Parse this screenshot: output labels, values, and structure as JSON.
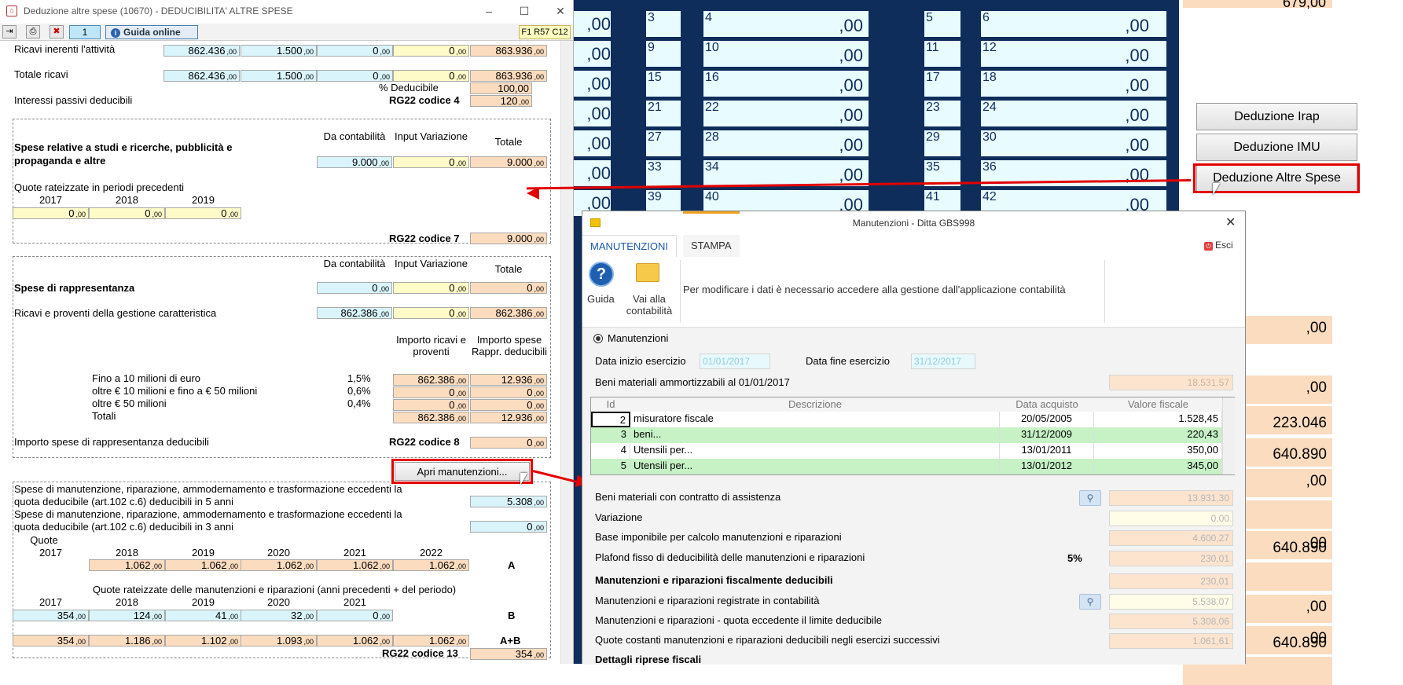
{
  "left_window": {
    "title": "Deduzione altre spese (10670) - DEDUCIBILITA' ALTRE SPESE",
    "toolbar": {
      "page_number": "1",
      "guida_label": "Guida online",
      "code": "F1 R57 C12"
    },
    "dec": ",00",
    "ricavi_inerenti": {
      "label": "Ricavi inerenti l'attività",
      "v1": "862.436",
      "v2": "1.500",
      "v3": "0",
      "v4": "0",
      "v5": "863.936"
    },
    "totale_ricavi": {
      "label": "Totale ricavi",
      "v1": "862.436",
      "v2": "1.500",
      "v3": "0",
      "v4": "0",
      "v5": "863.936"
    },
    "pct_deducibile": {
      "label": "% Deducibile",
      "value": "100,00"
    },
    "interessi": {
      "label": "Interessi passivi deducibili",
      "code": "RG22 codice 4",
      "value": "120"
    },
    "studi": {
      "title": "Spese relative a studi e ricerche, pubblicità e propaganda e altre",
      "h1": "Da contabilità",
      "h2": "Input Variazione",
      "h3": "Totale",
      "v1": "9.000",
      "v2": "0",
      "v3": "9.000",
      "quote_label": "Quote rateizzate in periodi precedenti",
      "years": [
        "2017",
        "2018",
        "2019"
      ],
      "quote_vals": [
        "0",
        "0",
        "0"
      ],
      "code": "RG22 codice 7",
      "total": "9.000"
    },
    "rappr": {
      "title": "Spese di rappresentanza",
      "h1": "Da contabilità",
      "h2": "Input Variazione",
      "h3": "Totale",
      "v1": "0",
      "v2": "0",
      "v3": "0",
      "ricavi_label": "Ricavi e proventi della gestione caratteristica",
      "r1": "862.386",
      "r2": "0",
      "r3": "862.386",
      "col_a": "Importo ricavi e proventi",
      "col_b": "Importo spese Rappr. deducibili",
      "rows": [
        {
          "label": "Fino a 10 milioni di euro",
          "pct": "1,5%",
          "a": "862.386",
          "b": "12.936"
        },
        {
          "label": "oltre € 10 milioni e fino a € 50 milioni",
          "pct": "0,6%",
          "a": "0",
          "b": "0"
        },
        {
          "label": "oltre € 50 milioni",
          "pct": "0,4%",
          "a": "0",
          "b": "0"
        },
        {
          "label": "Totali",
          "pct": "",
          "a": "862.386",
          "b": "12.936"
        }
      ],
      "importo_label": "Importo spese di rappresentanza deducibili",
      "code": "RG22 codice 8",
      "value": "0"
    },
    "apri_button": "Apri manutenzioni...",
    "manut": {
      "line1": "Spese di manutenzione, riparazione, ammodernamento e trasformazione eccedenti la",
      "line1b": "quota deducibile (art.102 c.6) deducibili in 5 anni",
      "v5": "5.308",
      "line2": "Spese di manutenzione, riparazione, ammodernamento e trasformazione eccedenti la",
      "line2b": "quota deducibile (art.102 c.6) deducibili in 3 anni",
      "v3": "0",
      "quote_label": "Quote",
      "years_a": [
        "2017",
        "2018",
        "2019",
        "2020",
        "2021",
        "2022"
      ],
      "vals_a": [
        "1.062",
        "1.062",
        "1.062",
        "1.062",
        "1.062"
      ],
      "label_a": "A",
      "rateizzate_label": "Quote rateizzate delle manutenzioni e riparazioni (anni precedenti + del periodo)",
      "years_b": [
        "2017",
        "2018",
        "2019",
        "2020",
        "2021"
      ],
      "vals_b": [
        "354",
        "124",
        "41",
        "32",
        "0"
      ],
      "label_b": "B",
      "vals_ab": [
        "354",
        "1.186",
        "1.102",
        "1.093",
        "1.062",
        "1.062"
      ],
      "label_ab": "A+B",
      "code": "RG22 codice 13",
      "total": "354"
    }
  },
  "background": {
    "top_value": "679,00",
    "grid_numbers": [
      "3",
      "4",
      "5",
      "6",
      "9",
      "10",
      "11",
      "12",
      "15",
      "16",
      "17",
      "18",
      "21",
      "22",
      "23",
      "24",
      "27",
      "28",
      "29",
      "30",
      "33",
      "34",
      "35",
      "36",
      "39",
      "40",
      "41",
      "42"
    ],
    "zero": ",00",
    "buttons": [
      "Deduzione Irap",
      "Deduzione IMU",
      "Deduzione Altre Spese"
    ],
    "right_values": [
      "223.046",
      "640.890",
      "640.890",
      "640.890"
    ]
  },
  "dialog": {
    "title": "Manutenzioni - Ditta GBS998",
    "tabs": [
      "MANUTENZIONI",
      "STAMPA"
    ],
    "esci": "Esci",
    "guida": "Guida",
    "vai": "Vai alla contabilità",
    "info": "Per modificare i dati è necessario accedere alla gestione dall'applicazione contabilità",
    "radio_label": "Manutenzioni",
    "data_inizio_label": "Data inizio esercizio",
    "data_inizio": "01/01/2017",
    "data_fine_label": "Data fine esercizio",
    "data_fine": "31/12/2017",
    "beni_label": "Beni materiali ammortizzabili al 01/01/2017",
    "beni_value": "18.531,57",
    "grid_headers": [
      "Id",
      "Descrizione",
      "Data acquisto",
      "Valore fiscale"
    ],
    "grid_rows": [
      {
        "id": "2",
        "desc": "misuratore fiscale",
        "date": "20/05/2005",
        "val": "1.528,45"
      },
      {
        "id": "3",
        "desc": "beni...",
        "date": "31/12/2009",
        "val": "220,43"
      },
      {
        "id": "4",
        "desc": "Utensili per...",
        "date": "13/01/2011",
        "val": "350,00"
      },
      {
        "id": "5",
        "desc": "Utensili per...",
        "date": "13/01/2012",
        "val": "345,00"
      }
    ],
    "assistenza_label": "Beni materiali con contratto di assistenza",
    "assistenza_value": "13.931,30",
    "variazione_label": "Variazione",
    "variazione_value": "0,00",
    "base_label": "Base imponibile per calcolo manutenzioni e riparazioni",
    "base_value": "4.600,27",
    "plafond_label": "Plafond fisso di deducibilità delle manutenzioni e riparazioni",
    "plafond_pct": "5%",
    "plafond_value": "230,01",
    "fisc_label": "Manutenzioni e riparazioni fiscalmente deducibili",
    "fisc_value": "230,01",
    "reg_label": "Manutenzioni e riparazioni registrate in contabilità",
    "reg_value": "5.538,07",
    "ecc_label": "Manutenzioni e riparazioni - quota eccedente il limite deducibile",
    "ecc_value": "5.308,06",
    "quote_label": "Quote costanti manutenzioni e riparazioni deducibili negli esercizi successivi",
    "quote_value": "1.061,61",
    "dettagli_label": "Dettagli riprese fiscali"
  }
}
